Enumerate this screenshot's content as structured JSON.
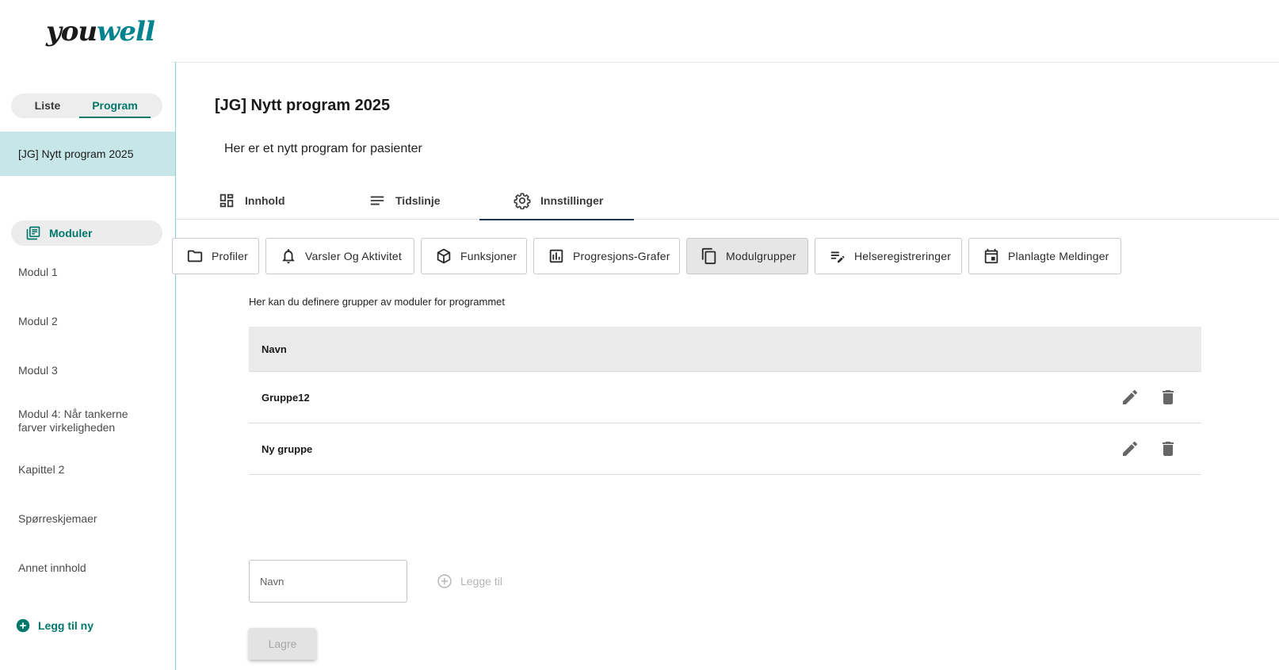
{
  "logo": {
    "part1": "you",
    "part2": "well"
  },
  "sidebar": {
    "toggle": {
      "liste": "Liste",
      "program": "Program"
    },
    "selected_program": "[JG] Nytt program 2025",
    "moduler_label": "Moduler",
    "items": [
      {
        "label": "Modul 1"
      },
      {
        "label": "Modul 2"
      },
      {
        "label": "Modul 3"
      },
      {
        "label": "Modul 4: Når tankerne farver virkeligheden"
      },
      {
        "label": "Kapittel 2"
      },
      {
        "label": "Spørreskjemaer"
      },
      {
        "label": "Annet innhold"
      }
    ],
    "add_new": "Legg til ny"
  },
  "main": {
    "title": "[JG] Nytt program 2025",
    "description": "Her er et nytt program for pasienter",
    "tabs": [
      {
        "label": "Innhold",
        "icon": "dashboard-icon"
      },
      {
        "label": "Tidslinje",
        "icon": "notes-icon"
      },
      {
        "label": "Innstillinger",
        "icon": "gear-icon",
        "active": true
      }
    ],
    "subtabs": [
      {
        "label": "Profiler",
        "icon": "folder-icon"
      },
      {
        "label": "Varsler Og Aktivitet",
        "icon": "bell-icon"
      },
      {
        "label": "Funksjoner",
        "icon": "package-icon"
      },
      {
        "label": "Progresjons-Grafer",
        "icon": "bar-chart-icon"
      },
      {
        "label": "Modulgrupper",
        "icon": "copy-icon",
        "active": true
      },
      {
        "label": "Helseregistreringer",
        "icon": "edit-note-icon"
      },
      {
        "label": "Planlagte Meldinger",
        "icon": "calendar-icon"
      }
    ],
    "section_description": "Her kan du definere grupper av moduler for programmet",
    "table": {
      "header": "Navn",
      "rows": [
        {
          "name": "Gruppe12"
        },
        {
          "name": "Ny gruppe"
        }
      ]
    },
    "name_input": {
      "placeholder": "Navn",
      "value": ""
    },
    "add_button": "Legge til",
    "save_button": "Lagre"
  },
  "colors": {
    "accent": "#00796b",
    "sidebar_selected": "#c6e6e7",
    "active_tab_underline": "#1d3557",
    "sidebar_border": "#8ed0d8"
  }
}
